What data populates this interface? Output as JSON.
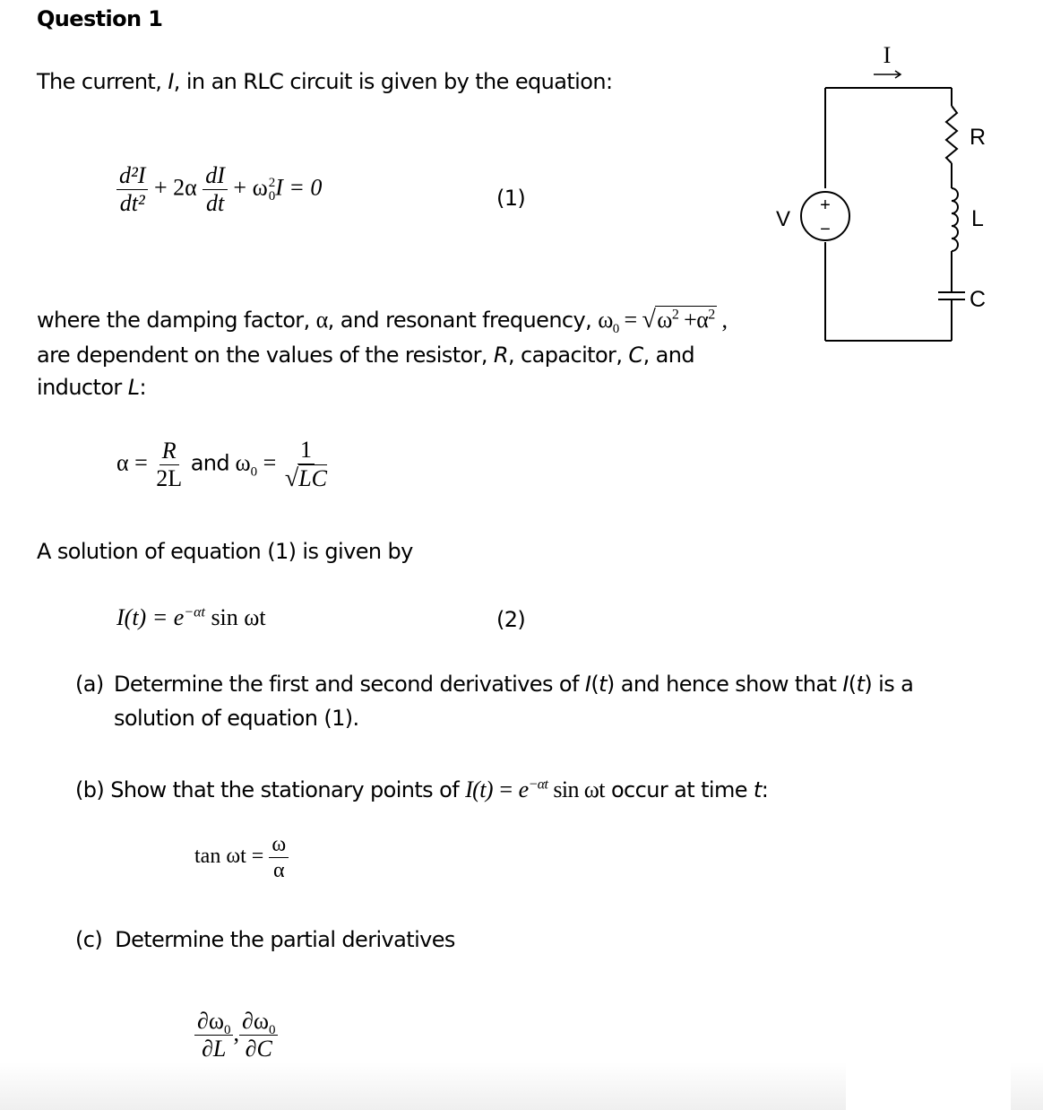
{
  "question": {
    "title": "Question 1",
    "intro": "The current, I, in an RLC circuit is given by the equation:",
    "intro_parts": {
      "before": "The current, ",
      "var": "I",
      "after": ", in an RLC circuit is given by the equation:"
    },
    "equation1": {
      "term1_num": "d²I",
      "term1_den": "dt²",
      "plus_2alpha": "+ 2α",
      "term2_num": "dI",
      "term2_den": "dt",
      "rest": "+ ω",
      "rest_sup": "2",
      "rest_sub": "0",
      "rest_tail": "I = 0",
      "label": "(1)"
    },
    "where_line1": "where the damping factor, α, and resonant frequency,",
    "where_line1_parts": {
      "a": "where the damping factor, ",
      "alpha": "α",
      "b": ", and resonant frequency, "
    },
    "omega0_def": {
      "lhs": "ω",
      "lhs_sub": "0",
      "eq": "=",
      "radicand_a": "ω",
      "radicand_a_sup": "2",
      "plus": "+",
      "radicand_b": "α",
      "radicand_b_sup": "2",
      "comma": ","
    },
    "where_line2_parts": {
      "a": "are dependent on the values of the resistor, ",
      "R": "R",
      "b": ", capacitor, ",
      "C": "C",
      "c": ", and"
    },
    "where_line3_parts": {
      "a": "inductor ",
      "L": "L",
      "b": ":"
    },
    "alpha_def": {
      "lhs": "α =",
      "num": "R",
      "den": "2L",
      "and": "and",
      "omega": "ω",
      "omega_sub": "0",
      "eq": "=",
      "num2": "1",
      "den2": "LC"
    },
    "solution_intro": "A solution of equation (1) is given by",
    "equation2": {
      "lhs": "I(t) = e",
      "exp": "−αt",
      "rhs": "sin ωt",
      "label": "(2)"
    },
    "part_a": {
      "label": "(a)",
      "line1_parts": {
        "a": "Determine the first and second derivatives of ",
        "It1": "I",
        "t1": "(",
        "tv1": "t",
        "t1c": ")",
        "b": " and hence show that ",
        "It2": "I",
        "t2": "(",
        "tv2": "t",
        "t2c": ")",
        "c": " is a"
      },
      "line2": "solution of equation (1)."
    },
    "part_b": {
      "label": "(b)",
      "text_a": "Show that the stationary points of",
      "expr": "I(t) = e",
      "expr_exp": "−αt",
      "expr_tail": "sin ωt",
      "text_b": "occur at time",
      "t": "t",
      "colon": ":",
      "tan_lhs": "tan ωt =",
      "tan_num": "ω",
      "tan_den": "α"
    },
    "part_c": {
      "label": "(c)",
      "text": "Determine the partial derivatives",
      "d1_num": "∂ω",
      "d1_sub": "0",
      "d1_den": "∂L",
      "comma": ",",
      "d2_num": "∂ω",
      "d2_sub": "0",
      "d2_den": "∂C"
    }
  },
  "circuit": {
    "current_label": "I",
    "source_label": "V",
    "plus_sign": "+",
    "minus_sign": "−",
    "resistor_label": "R",
    "inductor_label": "L",
    "capacitor_label": "C"
  }
}
